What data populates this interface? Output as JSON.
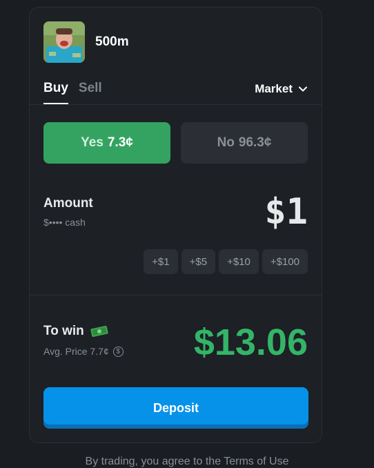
{
  "market": {
    "title": "500m",
    "thumbnail": "person-portrait"
  },
  "tabs": {
    "buy": "Buy",
    "sell": "Sell",
    "active": "Buy"
  },
  "order_type": {
    "label": "Market",
    "icon": "chevron-down-icon"
  },
  "outcomes": {
    "yes": {
      "label": "Yes",
      "price": "7.3¢",
      "color": "#34a361"
    },
    "no": {
      "label": "No",
      "price": "96.3¢",
      "color": "#2b2e35"
    }
  },
  "amount": {
    "label": "Amount",
    "value": "$1",
    "balance": "$•••• cash"
  },
  "increments": [
    "+$1",
    "+$5",
    "+$10",
    "+$100"
  ],
  "to_win": {
    "label": "To win",
    "icon": "money-icon",
    "value": "$13.06",
    "avg_price": "Avg. Price 7.7¢",
    "avg_icon": "dollar-info-icon"
  },
  "deposit": {
    "label": "Deposit",
    "color": "#0792ea"
  },
  "terms": {
    "text": "By trading, you agree to the Terms of Use"
  },
  "colors": {
    "background": "#1a1d21",
    "panel": "#1d2025",
    "win": "#34b468"
  }
}
